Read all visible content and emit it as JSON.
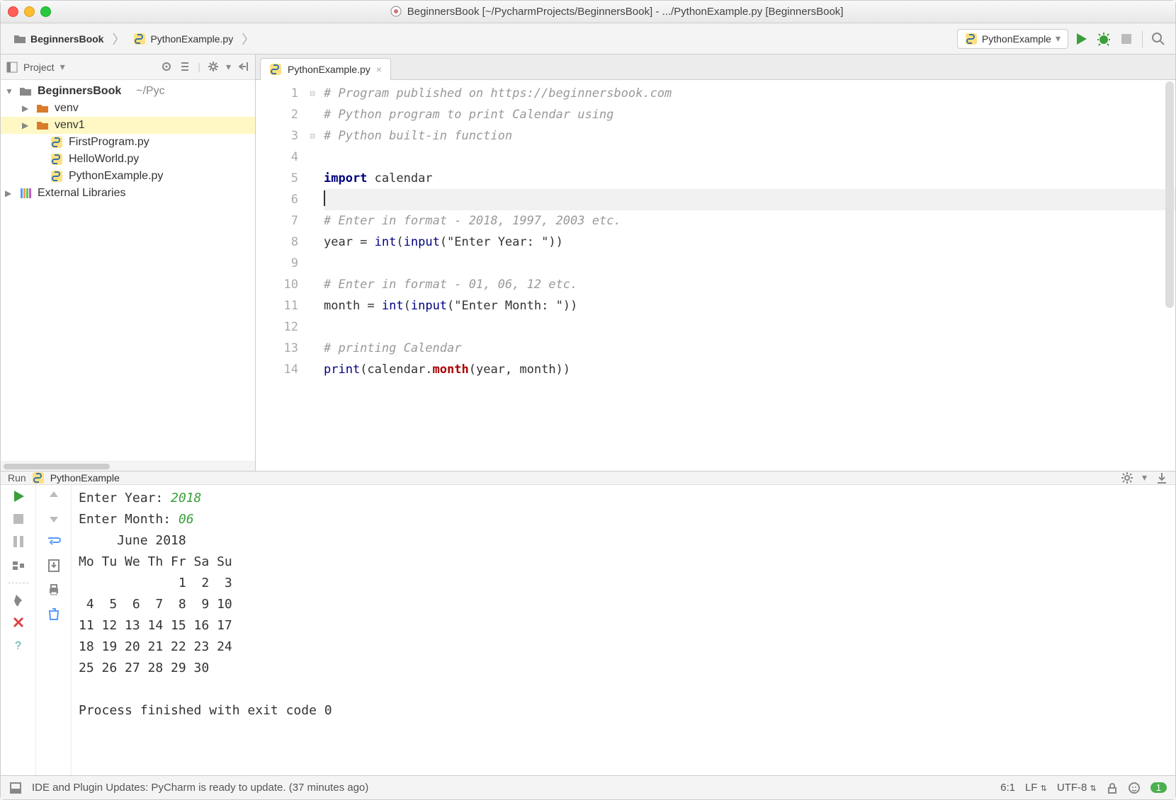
{
  "title": "BeginnersBook [~/PycharmProjects/BeginnersBook] - .../PythonExample.py [BeginnersBook]",
  "breadcrumb": {
    "root": "BeginnersBook",
    "file": "PythonExample.py"
  },
  "run_config": {
    "name": "PythonExample"
  },
  "sidebar": {
    "label": "Project",
    "project_root": "BeginnersBook",
    "project_path_suffix": "~/Pyc",
    "items": [
      {
        "name": "venv",
        "type": "folder"
      },
      {
        "name": "venv1",
        "type": "folder"
      },
      {
        "name": "FirstProgram.py",
        "type": "pyfile"
      },
      {
        "name": "HelloWorld.py",
        "type": "pyfile"
      },
      {
        "name": "PythonExample.py",
        "type": "pyfile"
      }
    ],
    "external": "External Libraries"
  },
  "editor": {
    "tab_name": "PythonExample.py",
    "lines": [
      "# Program published on https://beginnersbook.com",
      "# Python program to print Calendar using",
      "# Python built-in function",
      "",
      "import calendar",
      "",
      "# Enter in format - 2018, 1997, 2003 etc.",
      "year = int(input(\"Enter Year: \"))",
      "",
      "# Enter in format - 01, 06, 12 etc.",
      "month = int(input(\"Enter Month: \"))",
      "",
      "# printing Calendar",
      "print(calendar.month(year, month))"
    ],
    "cursor_line": 6
  },
  "run": {
    "tab_label": "Run",
    "config_name": "PythonExample",
    "output_segments": [
      {
        "t": "Enter Year: ",
        "c": "plain"
      },
      {
        "t": "2018",
        "c": "input"
      },
      {
        "t": "\n",
        "c": "plain"
      },
      {
        "t": "Enter Month: ",
        "c": "plain"
      },
      {
        "t": "06",
        "c": "input"
      },
      {
        "t": "\n",
        "c": "plain"
      },
      {
        "t": "     June 2018\n",
        "c": "plain"
      },
      {
        "t": "Mo Tu We Th Fr Sa Su\n",
        "c": "plain"
      },
      {
        "t": "             1  2  3\n",
        "c": "plain"
      },
      {
        "t": " 4  5  6  7  8  9 10\n",
        "c": "plain"
      },
      {
        "t": "11 12 13 14 15 16 17\n",
        "c": "plain"
      },
      {
        "t": "18 19 20 21 22 23 24\n",
        "c": "plain"
      },
      {
        "t": "25 26 27 28 29 30\n",
        "c": "plain"
      },
      {
        "t": "\n",
        "c": "plain"
      },
      {
        "t": "Process finished with exit code 0\n",
        "c": "plain"
      }
    ]
  },
  "status": {
    "message": "IDE and Plugin Updates: PyCharm is ready to update. (37 minutes ago)",
    "pos": "6:1",
    "line_sep": "LF",
    "encoding": "UTF-8",
    "badge": "1"
  }
}
